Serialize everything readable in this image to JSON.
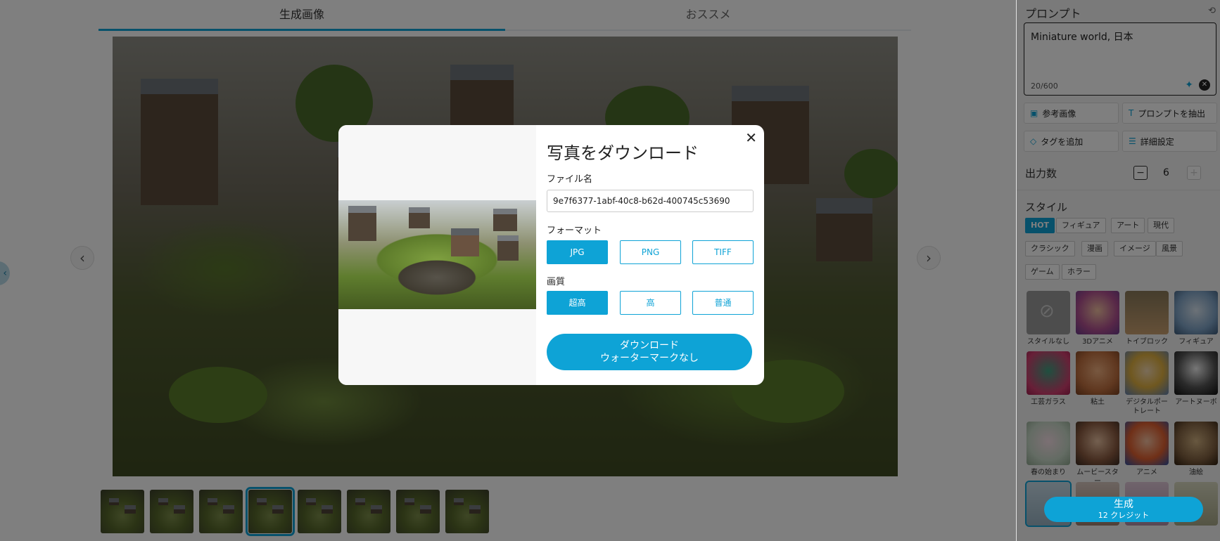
{
  "tabs": {
    "generated": "生成画像",
    "recommended": "おススメ"
  },
  "sidebar": {
    "prompt_title": "プロンプト",
    "prompt_text": "Miniature world, 日本",
    "char_counter": "20/600",
    "buttons": {
      "reference_image": "参考画像",
      "extract_prompt": "プロンプトを抽出",
      "add_tag": "タグを追加",
      "advanced_settings": "詳細設定"
    },
    "output_count_label": "出力数",
    "output_count": "6",
    "style_label": "スタイル",
    "style_chips": [
      "HOT",
      "フィギュア",
      "アート",
      "現代",
      "クラシック",
      "漫画",
      "イメージ",
      "風景",
      "ゲーム",
      "ホラー"
    ],
    "style_cards": [
      "スタイルなし",
      "3Dアニメ",
      "トイブロック",
      "フィギュア",
      "工芸ガラス",
      "粘土",
      "デジタルポートレート",
      "アートヌーボ",
      "春の始まり",
      "ムービースター",
      "アニメ",
      "油絵"
    ],
    "generate": {
      "label": "生成",
      "credits": "12 クレジット"
    }
  },
  "modal": {
    "title": "写真をダウンロード",
    "filename_label": "ファイル名",
    "filename": "9e7f6377-1abf-40c8-b62d-400745c53690",
    "format_label": "フォーマット",
    "formats": [
      "JPG",
      "PNG",
      "TIFF"
    ],
    "selected_format": "JPG",
    "quality_label": "画質",
    "qualities": [
      "超高",
      "高",
      "普通"
    ],
    "selected_quality": "超高",
    "download_line1": "ダウンロード",
    "download_line2": "ウォーターマークなし",
    "close_icon": "close-icon"
  },
  "colors": {
    "accent": "#0ea3d6",
    "overlay": "rgba(0,0,0,0.5)"
  }
}
